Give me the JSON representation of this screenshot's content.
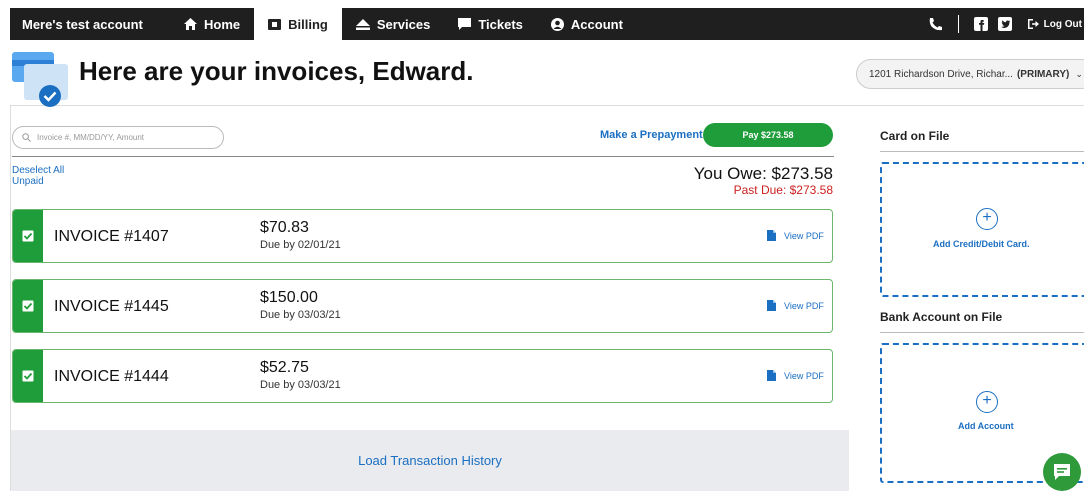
{
  "nav": {
    "account_name": "Mere's test account",
    "tabs": [
      {
        "label": "Home",
        "icon": "home-icon",
        "active": false
      },
      {
        "label": "Billing",
        "icon": "billing-icon",
        "active": true
      },
      {
        "label": "Services",
        "icon": "services-icon",
        "active": false
      },
      {
        "label": "Tickets",
        "icon": "tickets-icon",
        "active": false
      },
      {
        "label": "Account",
        "icon": "account-icon",
        "active": false
      }
    ],
    "right_icons": [
      "phone-icon",
      "facebook-icon",
      "twitter-icon"
    ],
    "logout_label": "Log Out"
  },
  "header": {
    "title": "Here are your invoices, Edward.",
    "address": "1201 Richardson Drive, Richar...",
    "address_tag": "(PRIMARY)"
  },
  "billing": {
    "search_placeholder": "Invoice #, MM/DD/YY, Amount",
    "prepay_label": "Make a Prepayment",
    "pay_label": "Pay $273.58",
    "deselect_label": "Deselect All",
    "unpaid_label": "Unpaid",
    "you_owe": "You Owe: $273.58",
    "past_due": "Past Due: $273.58",
    "invoices": [
      {
        "number": "INVOICE #1407",
        "amount": "$70.83",
        "due": "Due by 02/01/21",
        "pdf_label": "View PDF",
        "selected": true
      },
      {
        "number": "INVOICE #1445",
        "amount": "$150.00",
        "due": "Due by 03/03/21",
        "pdf_label": "View PDF",
        "selected": true
      },
      {
        "number": "INVOICE #1444",
        "amount": "$52.75",
        "due": "Due by 03/03/21",
        "pdf_label": "View PDF",
        "selected": true
      }
    ],
    "history_label": "Load Transaction History"
  },
  "sidebar": {
    "card_title": "Card on File",
    "card_add_label": "Add Credit/Debit Card.",
    "bank_title": "Bank Account on File",
    "bank_add_label": "Add Account"
  },
  "colors": {
    "nav_bg": "#1f1f1f",
    "accent_green": "#1f9d3a",
    "link_blue": "#1b6fc2",
    "past_due_red": "#cc1f1f",
    "history_bg": "#e9ebee"
  }
}
